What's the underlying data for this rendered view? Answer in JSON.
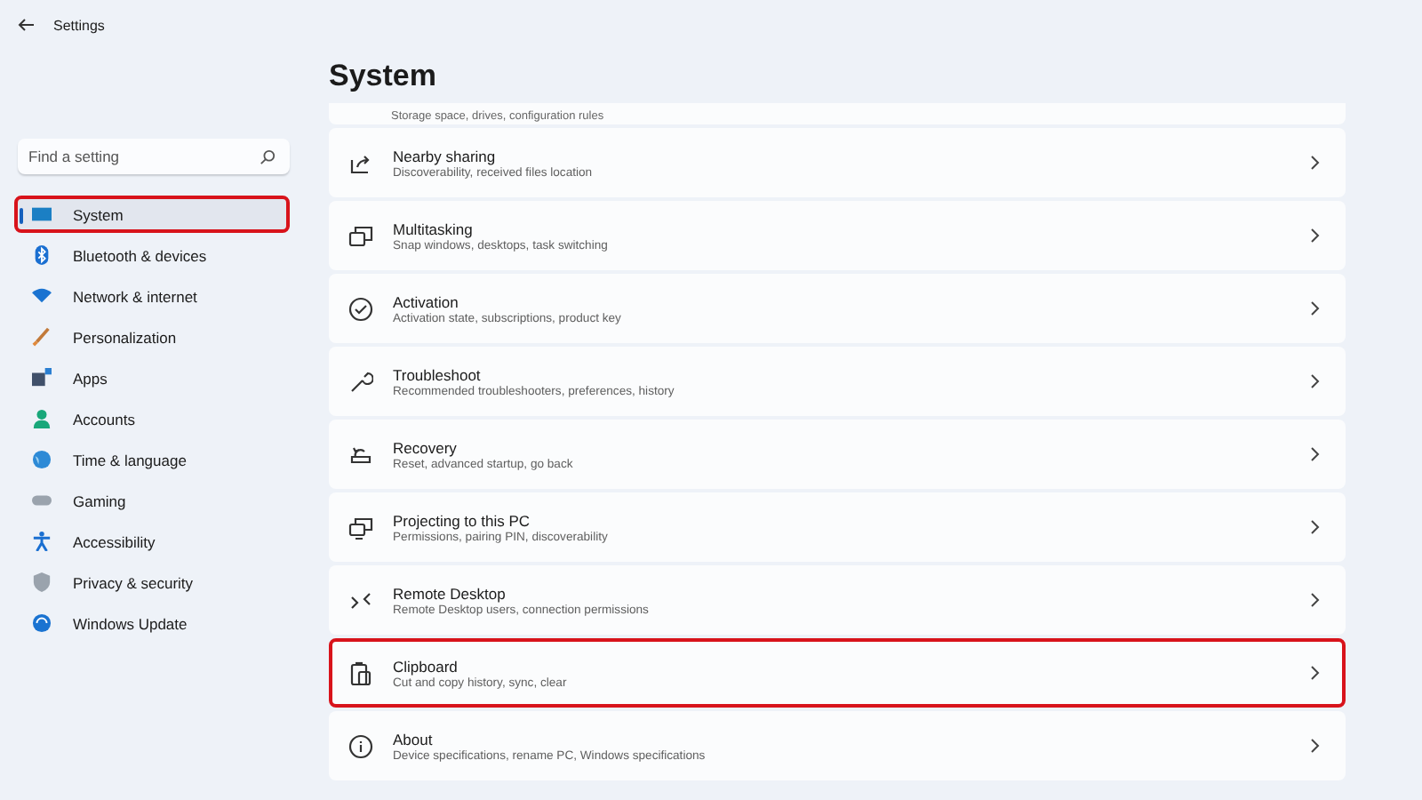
{
  "window": {
    "title": "Settings"
  },
  "search": {
    "placeholder": "Find a setting"
  },
  "sidebar": {
    "items": [
      {
        "label": "System",
        "selected": true,
        "highlighted": true
      },
      {
        "label": "Bluetooth & devices",
        "selected": false,
        "highlighted": false
      },
      {
        "label": "Network & internet",
        "selected": false,
        "highlighted": false
      },
      {
        "label": "Personalization",
        "selected": false,
        "highlighted": false
      },
      {
        "label": "Apps",
        "selected": false,
        "highlighted": false
      },
      {
        "label": "Accounts",
        "selected": false,
        "highlighted": false
      },
      {
        "label": "Time & language",
        "selected": false,
        "highlighted": false
      },
      {
        "label": "Gaming",
        "selected": false,
        "highlighted": false
      },
      {
        "label": "Accessibility",
        "selected": false,
        "highlighted": false
      },
      {
        "label": "Privacy & security",
        "selected": false,
        "highlighted": false
      },
      {
        "label": "Windows Update",
        "selected": false,
        "highlighted": false
      }
    ]
  },
  "page": {
    "title": "System",
    "cut_row": {
      "description": "Storage space, drives, configuration rules"
    },
    "rows": [
      {
        "title": "Nearby sharing",
        "description": "Discoverability, received files location",
        "highlighted": false
      },
      {
        "title": "Multitasking",
        "description": "Snap windows, desktops, task switching",
        "highlighted": false
      },
      {
        "title": "Activation",
        "description": "Activation state, subscriptions, product key",
        "highlighted": false
      },
      {
        "title": "Troubleshoot",
        "description": "Recommended troubleshooters, preferences, history",
        "highlighted": false
      },
      {
        "title": "Recovery",
        "description": "Reset, advanced startup, go back",
        "highlighted": false
      },
      {
        "title": "Projecting to this PC",
        "description": "Permissions, pairing PIN, discoverability",
        "highlighted": false
      },
      {
        "title": "Remote Desktop",
        "description": "Remote Desktop users, connection permissions",
        "highlighted": false
      },
      {
        "title": "Clipboard",
        "description": "Cut and copy history, sync, clear",
        "highlighted": true
      },
      {
        "title": "About",
        "description": "Device specifications, rename PC, Windows specifications",
        "highlighted": false
      }
    ]
  }
}
